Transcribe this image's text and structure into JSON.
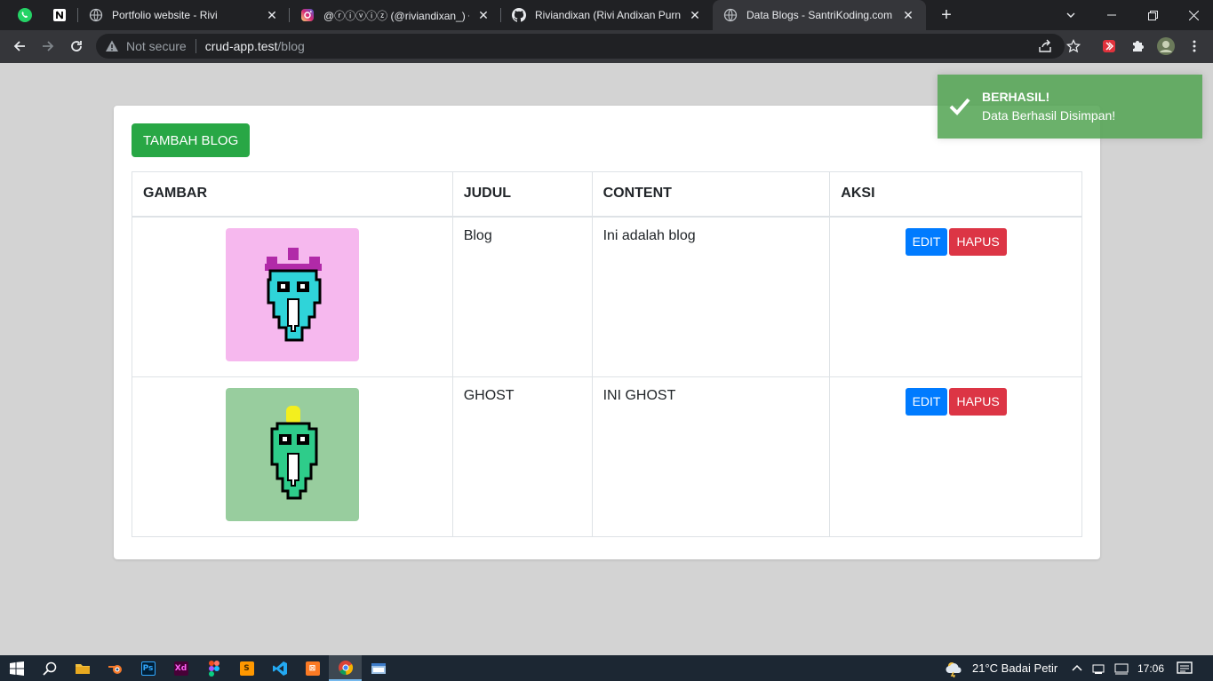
{
  "browser": {
    "tabs": [
      {
        "title": "Portfolio website - Rivi",
        "active": false
      },
      {
        "title": "@ⓡⓘⓥⓘⓩ (@riviandixan_) • Instagram",
        "active": false
      },
      {
        "title": "Riviandixan (Rivi Andixan Purnadi)",
        "active": false
      },
      {
        "title": "Data Blogs - SantriKoding.com",
        "active": true
      }
    ],
    "address": {
      "security_label": "Not secure",
      "host": "crud-app.test",
      "path": "/blog"
    }
  },
  "page": {
    "add_button_label": "TAMBAH BLOG",
    "table": {
      "headers": [
        "GAMBAR",
        "JUDUL",
        "CONTENT",
        "AKSI"
      ],
      "rows": [
        {
          "image_color": "#f6b8ee",
          "creature_color": "#2fd4d9",
          "crown_color": "#b12aa8",
          "judul": "Blog",
          "content": "Ini adalah blog",
          "edit_label": "EDIT",
          "delete_label": "HAPUS"
        },
        {
          "image_color": "#98cd9e",
          "creature_color": "#2ecc8a",
          "crown_color": "#f3ef1e",
          "judul": "GHOST",
          "content": "INI GHOST",
          "edit_label": "EDIT",
          "delete_label": "HAPUS"
        }
      ]
    }
  },
  "toast": {
    "title": "BERHASIL!",
    "message": "Data Berhasil Disimpan!",
    "color": "#51a351"
  },
  "taskbar": {
    "weather": "21°C  Badai Petir",
    "time": "17:06"
  },
  "colors": {
    "success": "#28a745",
    "primary": "#007bff",
    "danger": "#dc3545"
  }
}
